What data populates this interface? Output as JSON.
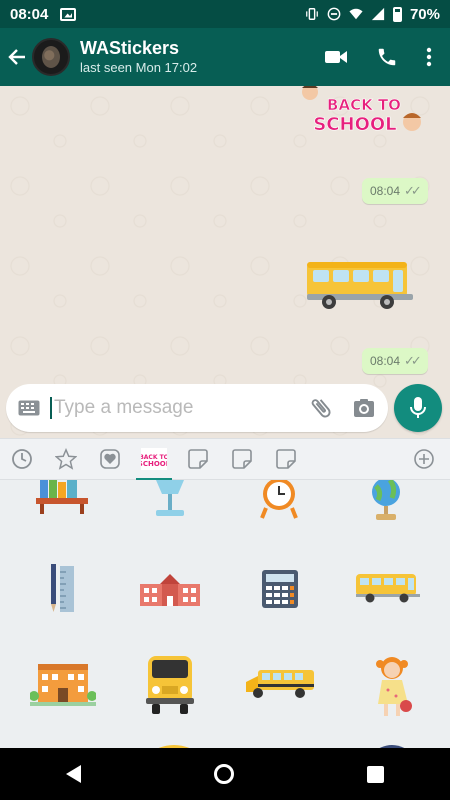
{
  "status_bar": {
    "time": "08:04",
    "battery": "70%"
  },
  "header": {
    "title": "WAStickers",
    "subtitle": "last seen Mon 17:02"
  },
  "chat": {
    "sticker_top_text": "BACK TO SCHOOL",
    "messages": [
      {
        "time": "08:04",
        "status": "read"
      },
      {
        "time": "08:04",
        "status": "read"
      }
    ]
  },
  "composer": {
    "placeholder": "Type a message"
  },
  "sticker_tabs": [
    "recent",
    "favorites",
    "heart-pack",
    "back-to-school-pack",
    "pack-5",
    "pack-6",
    "pack-7",
    "add"
  ],
  "colors": {
    "header": "#075e54",
    "status_bar": "#054d44",
    "accent": "#128c7e",
    "bubble": "#dcf8c6"
  }
}
